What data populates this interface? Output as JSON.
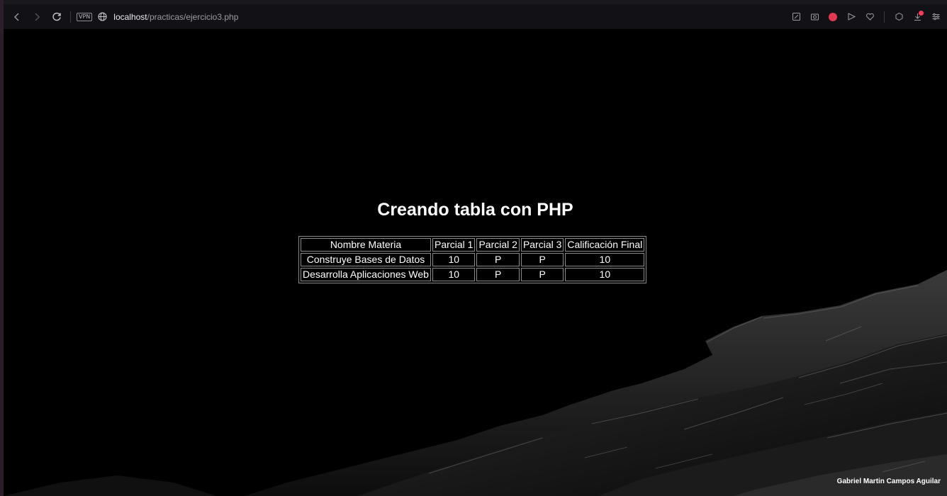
{
  "browser": {
    "vpn_label": "VPN",
    "url_host": "localhost",
    "url_path": "/practicas/ejercicio3.php",
    "accent_color": "#e3384f"
  },
  "page": {
    "title": "Creando tabla con PHP",
    "footer": "Gabriel Martin Campos Aguilar",
    "table": {
      "headers": [
        "Nombre Materia",
        "Parcial 1",
        "Parcial 2",
        "Parcial 3",
        "Calificación Final"
      ],
      "rows": [
        [
          "Construye Bases de Datos",
          "10",
          "P",
          "P",
          "10"
        ],
        [
          "Desarrolla Aplicaciones Web",
          "10",
          "P",
          "P",
          "10"
        ]
      ]
    }
  }
}
